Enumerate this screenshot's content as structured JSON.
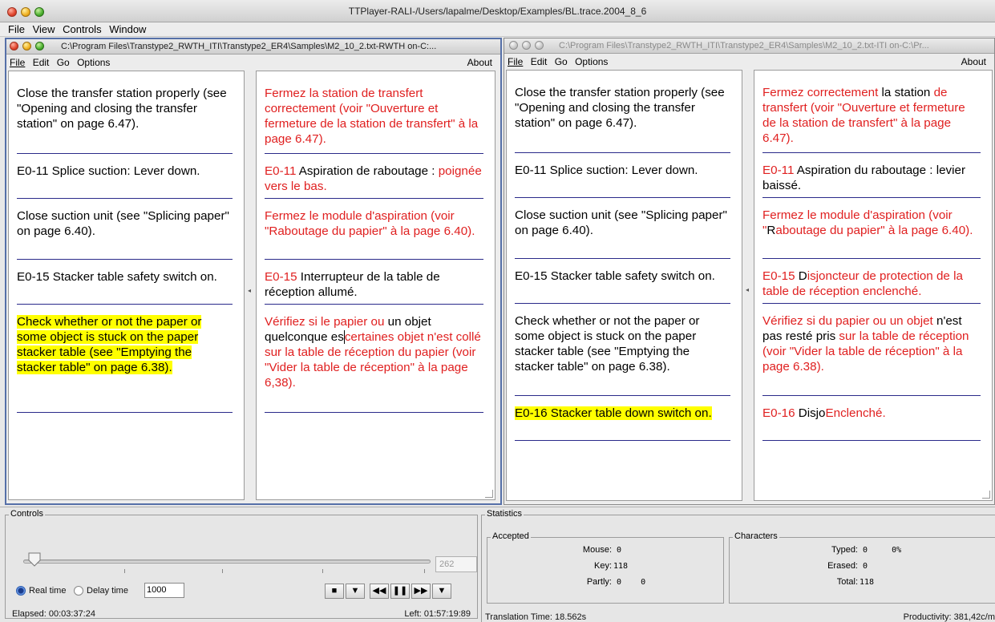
{
  "app": {
    "title": "TTPlayer-RALI-/Users/lapalme/Desktop/Examples/BL.trace.2004_8_6",
    "menu": [
      "File",
      "View",
      "Controls",
      "Window"
    ]
  },
  "left_window": {
    "title": "C:\\Program Files\\Transtype2_RWTH_ITI\\Transtype2_ER4\\Samples\\M2_10_2.txt-RWTH on-C:...",
    "menu": [
      "File",
      "Edit",
      "Go",
      "Options"
    ],
    "about": "About",
    "source": [
      "Close the transfer station properly (see \"Opening and closing the transfer station\" on page 6.47).",
      "E0-11 Splice suction: Lever down.",
      "Close suction unit (see \"Splicing paper\" on page 6.40).",
      "E0-15 Stacker table safety switch on.",
      "Check whether or not the paper or some object is stuck on the paper stacker table (see \"Emptying the stacker table\" on page 6.38)."
    ],
    "target": {
      "t1": "Fermez la station de transfert correctement (voir \"Ouverture et fermeture de la station de transfert\" à la page 6.47).",
      "t2a": "E0-11",
      "t2b": " Aspiration de raboutage : ",
      "t2c": "poignée vers le bas.",
      "t3": "Fermez le module d'aspiration (voir \"Raboutage du papier\" à la page 6.40).",
      "t4a": "E0-15",
      "t4b": " Interrupteur de la table de réception allumé.",
      "t5a": "Vérifiez si le papier ou",
      "t5b": " un objet quelconque es",
      "t5c": "certaines objet n'est collé sur la table de réception du papier (voir \"Vider la table de réception\" à la page 6,38)."
    }
  },
  "right_window": {
    "title": "C:\\Program Files\\Transtype2_RWTH_ITI\\Transtype2_ER4\\Samples\\M2_10_2.txt-ITI on-C:\\Pr...",
    "menu": [
      "File",
      "Edit",
      "Go",
      "Options"
    ],
    "about": "About",
    "source": [
      "Close the transfer station properly (see \"Opening and closing the transfer station\" on page 6.47).",
      "E0-11 Splice suction: Lever down.",
      "Close suction unit (see \"Splicing paper\" on page 6.40).",
      "E0-15 Stacker table safety switch on.",
      "Check whether or not the paper or some object is stuck on the paper stacker table (see \"Emptying the stacker table\" on page 6.38).",
      "E0-16 Stacker table down switch on."
    ],
    "target": {
      "t1a": "Fermez correctement ",
      "t1b": "la station ",
      "t1c": "de transfert (voir \"Ouverture et fermeture de la station de transfert\" à la page 6.47).",
      "t2a": "E0-11",
      "t2b": " Aspiration du raboutage : levier baissé.",
      "t3a": "Fermez le module d'aspiration (voir \"",
      "t3b": "R",
      "t3c": "aboutage du papier\" à la page 6.40).",
      "t4a": "E0-15",
      "t4b": " D",
      "t4c": "isjoncteur de protection de la table de réception enclenché.",
      "t5a": "Vérifiez si du papier ou un objet ",
      "t5b": "n",
      "t5c": "'est pas resté pris ",
      "t5d": "sur la table de réception (voir \"Vider la table de réception\" à la page 6.38).",
      "t6a": "E0-16",
      "t6b": " Disjo",
      "t6c": "Enclenché."
    }
  },
  "controls": {
    "label": "Controls",
    "slider_value": "262",
    "real_time": "Real time",
    "delay_time": "Delay time",
    "delay_value": "1000",
    "elapsed": "Elapsed: 00:03:37:24",
    "left": "Left: 01:57:19:89"
  },
  "statistics": {
    "label": "Statistics",
    "accepted_label": "Accepted",
    "mouse_label": "Mouse:",
    "mouse_value": "0",
    "key_label": "Key:",
    "key_value": "118",
    "partly_label": "Partly:",
    "partly_value": "0    0",
    "characters_label": "Characters",
    "typed_label": "Typed:",
    "typed_value": "0     0%",
    "erased_label": "Erased:",
    "erased_value": "0",
    "total_label": "Total:",
    "total_value": "118",
    "translation_time": "Translation Time: 18.562s",
    "productivity": "Productivity: 381,42c/m"
  },
  "colors": {
    "target_text": "#e02020",
    "highlight": "#ffff00",
    "separator": "#2a2a8a",
    "active_border": "#5670a8"
  }
}
